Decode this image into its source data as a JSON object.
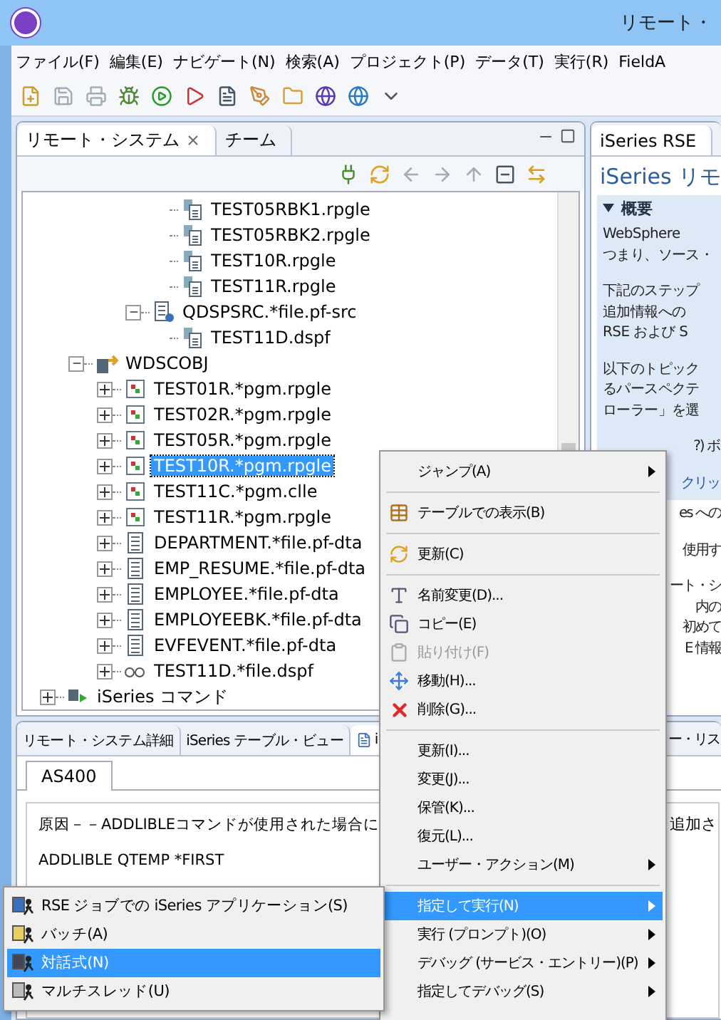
{
  "window": {
    "title": "リモート・"
  },
  "menu_bar": [
    "ファイル(F)",
    "編集(E)",
    "ナビゲート(N)",
    "検索(A)",
    "プロジェクト(P)",
    "データ(T)",
    "実行(R)",
    "FieldA"
  ],
  "left_panel": {
    "tabs": [
      {
        "label": "リモート・システム",
        "selected": true,
        "closable": true
      },
      {
        "label": "チーム",
        "selected": false,
        "closable": false
      }
    ],
    "tree": [
      {
        "children": [
          {
            "children": [
              {
                "children": [
                  {
                    "children": [
                      {
                        "label": "TEST05RBK1.rpgle",
                        "kind": "member",
                        "selected": false
                      },
                      {
                        "label": "TEST05RBK2.rpgle",
                        "kind": "member",
                        "selected": false
                      },
                      {
                        "label": "TEST10R.rpgle",
                        "kind": "member",
                        "selected": false
                      },
                      {
                        "label": "TEST11R.rpgle",
                        "kind": "member",
                        "selected": false
                      }
                    ]
                  },
                  {
                    "label": "QDSPSRC.*file.pf-src",
                    "kind": "srcfile",
                    "expanded": true,
                    "selected": false,
                    "children": [
                      {
                        "label": "TEST11D.dspf",
                        "kind": "member",
                        "selected": false
                      }
                    ]
                  }
                ]
              }
            ]
          },
          {
            "label": "WDSCOBJ",
            "kind": "library",
            "expanded": true,
            "selected": false,
            "children": [
              {
                "label": "TEST01R.*pgm.rpgle",
                "kind": "program",
                "expanded": false,
                "selected": false
              },
              {
                "label": "TEST02R.*pgm.rpgle",
                "kind": "program",
                "expanded": false,
                "selected": false
              },
              {
                "label": "TEST05R.*pgm.rpgle",
                "kind": "program",
                "expanded": false,
                "selected": false
              },
              {
                "label": "TEST10R.*pgm.rpgle",
                "kind": "program",
                "expanded": false,
                "selected": true
              },
              {
                "label": "TEST11C.*pgm.clle",
                "kind": "program",
                "expanded": false,
                "selected": false
              },
              {
                "label": "TEST11R.*pgm.rpgle",
                "kind": "program",
                "expanded": false,
                "selected": false
              },
              {
                "label": "DEPARTMENT.*file.pf-dta",
                "kind": "datafile",
                "expanded": false,
                "selected": false
              },
              {
                "label": "EMP_RESUME.*file.pf-dta",
                "kind": "datafile",
                "expanded": false,
                "selected": false
              },
              {
                "label": "EMPLOYEE.*file.pf-dta",
                "kind": "datafile",
                "expanded": false,
                "selected": false
              },
              {
                "label": "EMPLOYEEBK.*file.pf-dta",
                "kind": "datafile",
                "expanded": false,
                "selected": false
              },
              {
                "label": "EVFEVENT.*file.pf-dta",
                "kind": "datafile",
                "expanded": false,
                "selected": false
              },
              {
                "label": "TEST11D.*file.dspf",
                "kind": "displayfile",
                "expanded": false,
                "selected": false
              }
            ]
          }
        ]
      },
      {
        "label": "iSeries コマンド",
        "kind": "commands",
        "expanded": false,
        "selected": false
      }
    ]
  },
  "right_panel": {
    "tab": "iSeries RSE",
    "title": "iSeries リモ",
    "section": {
      "title": "概要",
      "expanded": true,
      "paragraphs": [
        {
          "lines": [
            "WebSphere",
            "つまり、ソース・"
          ],
          "covered": false,
          "link": false
        },
        {
          "lines": [
            "下記のステップ",
            "追加情報への",
            "RSE および S"
          ],
          "covered": false,
          "link": false
        },
        {
          "lines": [
            "以下のトピック",
            "るパースペクテ",
            "ローラー」を選"
          ],
          "covered": false,
          "link": false
        },
        {
          "lines": [
            "?) ボ"
          ],
          "covered": true,
          "link": false
        },
        {
          "lines": [
            "クリッ"
          ],
          "covered": true,
          "link": true
        }
      ]
    },
    "paragraphs": [
      {
        "lines": [
          "es への"
        ],
        "covered": true,
        "link": false
      },
      {
        "lines": [
          "使用す"
        ],
        "covered": true,
        "link": false
      },
      {
        "lines": [
          "ート・シ",
          "内の",
          "初めて",
          "E 情報"
        ],
        "covered": true,
        "link": false
      }
    ]
  },
  "bottom_panel": {
    "tabs": [
      {
        "label": "リモート・システム詳細",
        "selected": false
      },
      {
        "label": "iSeries テーブル・ビュー",
        "selected": false
      },
      {
        "label": "i",
        "selected": true
      }
    ],
    "right_tab_fragment": "ー・リス",
    "inner_tabs": [
      {
        "label": "AS400",
        "selected": true
      }
    ],
    "lines": [
      {
        "text": "原因－－ADDLIBLEコマンドが使用された場合に",
        "tail": "追加さ"
      },
      {
        "text": "ADDLIBLE QTEMP *FIRST"
      }
    ]
  },
  "context_menu": [
    {
      "kind": "plain",
      "label": "ジャンプ(A)",
      "submenu": true,
      "disabled": false,
      "selected": false
    },
    {
      "kind": "separator"
    },
    {
      "kind": "table-view",
      "label": "テーブルでの表示(B)",
      "submenu": false,
      "disabled": false,
      "selected": false
    },
    {
      "kind": "separator"
    },
    {
      "kind": "refresh",
      "label": "更新(C)",
      "submenu": false,
      "disabled": false,
      "selected": false
    },
    {
      "kind": "separator"
    },
    {
      "kind": "rename",
      "label": "名前変更(D)...",
      "submenu": false,
      "disabled": false,
      "selected": false
    },
    {
      "kind": "copy",
      "label": "コピー(E)",
      "submenu": false,
      "disabled": false,
      "selected": false
    },
    {
      "kind": "paste",
      "label": "貼り付け(F)",
      "submenu": false,
      "disabled": true,
      "selected": false
    },
    {
      "kind": "move",
      "label": "移動(H)...",
      "submenu": false,
      "disabled": false,
      "selected": false
    },
    {
      "kind": "delete",
      "label": "削除(G)...",
      "submenu": false,
      "disabled": false,
      "selected": false
    },
    {
      "kind": "separator"
    },
    {
      "kind": "plain",
      "label": "更新(I)...",
      "submenu": false,
      "disabled": false,
      "selected": false
    },
    {
      "kind": "plain",
      "label": "変更(J)...",
      "submenu": false,
      "disabled": false,
      "selected": false
    },
    {
      "kind": "plain",
      "label": "保管(K)...",
      "submenu": false,
      "disabled": false,
      "selected": false
    },
    {
      "kind": "plain",
      "label": "復元(L)...",
      "submenu": false,
      "disabled": false,
      "selected": false
    },
    {
      "kind": "plain",
      "label": "ユーザー・アクション(M)",
      "submenu": true,
      "disabled": false,
      "selected": false
    },
    {
      "kind": "separator"
    },
    {
      "kind": "plain",
      "label": "指定して実行(N)",
      "submenu": true,
      "disabled": false,
      "selected": true
    },
    {
      "kind": "plain",
      "label": "実行 (プロンプト)(O)",
      "submenu": true,
      "disabled": false,
      "selected": false
    },
    {
      "kind": "plain",
      "label": "デバッグ (サービス・エントリー)(P)",
      "submenu": true,
      "disabled": false,
      "selected": false
    },
    {
      "kind": "plain",
      "label": "指定してデバッグ(S)",
      "submenu": true,
      "disabled": false,
      "selected": false
    }
  ],
  "submenu": [
    {
      "kind": "rse-job",
      "label": "RSE ジョブでの iSeries アプリケーション(S)",
      "selected": false
    },
    {
      "kind": "batch",
      "label": "バッチ(A)",
      "selected": false
    },
    {
      "kind": "interactive",
      "label": "対話式(N)",
      "selected": true
    },
    {
      "kind": "multithread",
      "label": "マルチスレッド(U)",
      "selected": false
    }
  ]
}
